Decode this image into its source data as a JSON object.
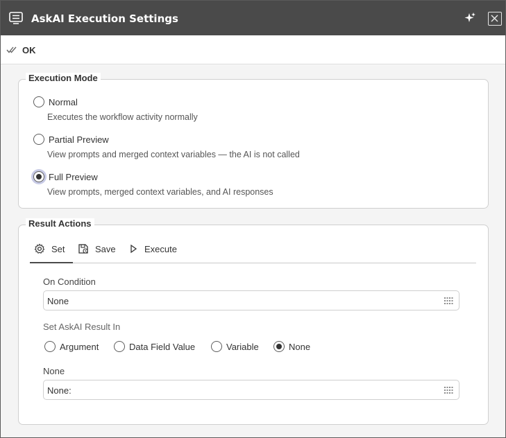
{
  "window": {
    "title": "AskAI Execution Settings",
    "icons": {
      "app": "settings-dialog-icon",
      "pin": "pin-sparkle-icon",
      "close": "close-icon"
    }
  },
  "toolbar": {
    "ok_label": "OK",
    "ok_icon": "double-check-icon"
  },
  "execution_mode": {
    "legend": "Execution Mode",
    "selected": "Full Preview",
    "options": [
      {
        "label": "Normal",
        "description": "Executes the workflow activity normally",
        "checked": false
      },
      {
        "label": "Partial Preview",
        "description": "View prompts and merged context variables — the AI is not called",
        "checked": false
      },
      {
        "label": "Full Preview",
        "description": "View prompts, merged context variables, and AI responses",
        "checked": true
      }
    ]
  },
  "result_actions": {
    "legend": "Result Actions",
    "tabs": [
      {
        "label": "Set",
        "icon": "gear-icon",
        "active": true
      },
      {
        "label": "Save",
        "icon": "save-icon",
        "active": false
      },
      {
        "label": "Execute",
        "icon": "play-icon",
        "active": false
      }
    ],
    "on_condition": {
      "label": "On Condition",
      "value": "None"
    },
    "set_result_in": {
      "label": "Set AskAI Result In",
      "selected": "None",
      "options": [
        "Argument",
        "Data Field Value",
        "Variable",
        "None"
      ]
    },
    "target": {
      "label": "None",
      "value": "None:"
    }
  },
  "colors": {
    "titlebar": "#4a4a4a",
    "border": "#cfcfcf",
    "focus_ring": "#c8cbe6"
  }
}
